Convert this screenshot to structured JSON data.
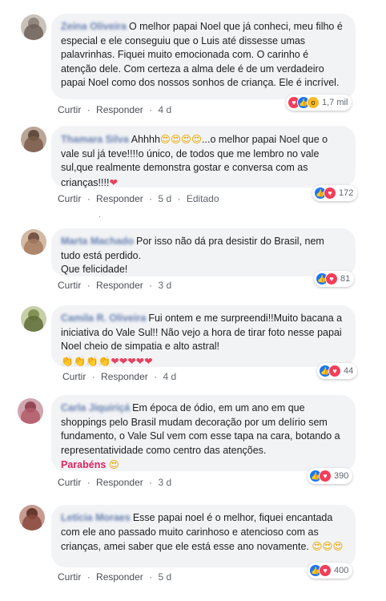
{
  "comments": [
    {
      "author": "Zeina Oliveira",
      "text": "O melhor papai Noel que já conheci, meu filho é especial e ele conseguiu que o Luis até dissesse umas palavrinhas. Fiquei muito emocionada com. O carinho é atenção dele. Com certeza a alma dele é de um verdadeiro papai Noel como dos nossos sonhos de criança. Ele é incrível.",
      "actions": {
        "like": "Curtir",
        "reply": "Responder",
        "time": "4 d"
      },
      "reactions": {
        "icons": [
          "love-icon",
          "like-icon",
          "wow-icon"
        ],
        "count": "1,7 mil"
      },
      "avatar_color": "#bdb6ad"
    },
    {
      "author": "Thamara Silva",
      "text_before": "Ahhhh",
      "emoji_1": "😍😍😍😍",
      "text_after": "...o melhor papai Noel que o vale sul já teve!!!!o único, de todos que me lembro no vale sul,que realmente demonstra gostar e conversa com as crianças!!!!",
      "emoji_2": "❤",
      "actions": {
        "like": "Curtir",
        "reply": "Responder",
        "time": "5 d",
        "edited": "Editado"
      },
      "reactions": {
        "icons": [
          "like-icon",
          "love-icon"
        ],
        "count": "172"
      },
      "avatar_color": "#8a6f5c"
    },
    {
      "author": "Marta Machado",
      "text": "Por isso não dá pra desistir do Brasil, nem tudo está perdido.\nQue felicidade!",
      "actions": {
        "like": "Curtir",
        "reply": "Responder",
        "time": "3 d"
      },
      "reactions": {
        "icons": [
          "like-icon",
          "love-icon"
        ],
        "count": "81"
      },
      "avatar_color": "#a27f66"
    },
    {
      "author": "Camila R. Oliveira",
      "text": "Fui ontem e me surpreendi!!Muito bacana a iniciativa do Vale Sul!! Não vejo a hora de tirar foto nesse papai Noel cheio de simpatia e alto astral!",
      "emoji_claps": "👏👏👏👏",
      "emoji_hearts": "❤❤❤❤❤",
      "actions": {
        "like": "Curtir",
        "reply": "Responder",
        "time": "4 d"
      },
      "reactions": {
        "icons": [
          "like-icon",
          "love-icon"
        ],
        "count": "44"
      },
      "avatar_color": "#9aa86f"
    },
    {
      "author": "Carla Jiquiriçá",
      "text": "Em época de ódio, em um ano em que shoppings pelo Brasil mudam decoração por um delírio sem fundamento, o Vale Sul vem com esse tapa na cara, botando a representatividade como centro das atenções.",
      "parabens": "Parabéns",
      "emoji": "😍",
      "actions": {
        "like": "Curtir",
        "reply": "Responder",
        "time": "3 d"
      },
      "reactions": {
        "icons": [
          "like-icon",
          "love-icon"
        ],
        "count": "390"
      },
      "avatar_color": "#b07b86"
    },
    {
      "author": "Letícia Moraes",
      "text": "Esse papai noel é o melhor, fiquei encantada com ele ano passado muito carinhoso e atencioso com as crianças, amei saber que ele está esse ano novamente.",
      "emoji": "😍😍😍",
      "actions": {
        "like": "Curtir",
        "reply": "Responder",
        "time": "5 d"
      },
      "reactions": {
        "icons": [
          "like-icon",
          "love-icon"
        ],
        "count": "400"
      },
      "avatar_color": "#9c5e52"
    }
  ],
  "separator_dot": "·"
}
